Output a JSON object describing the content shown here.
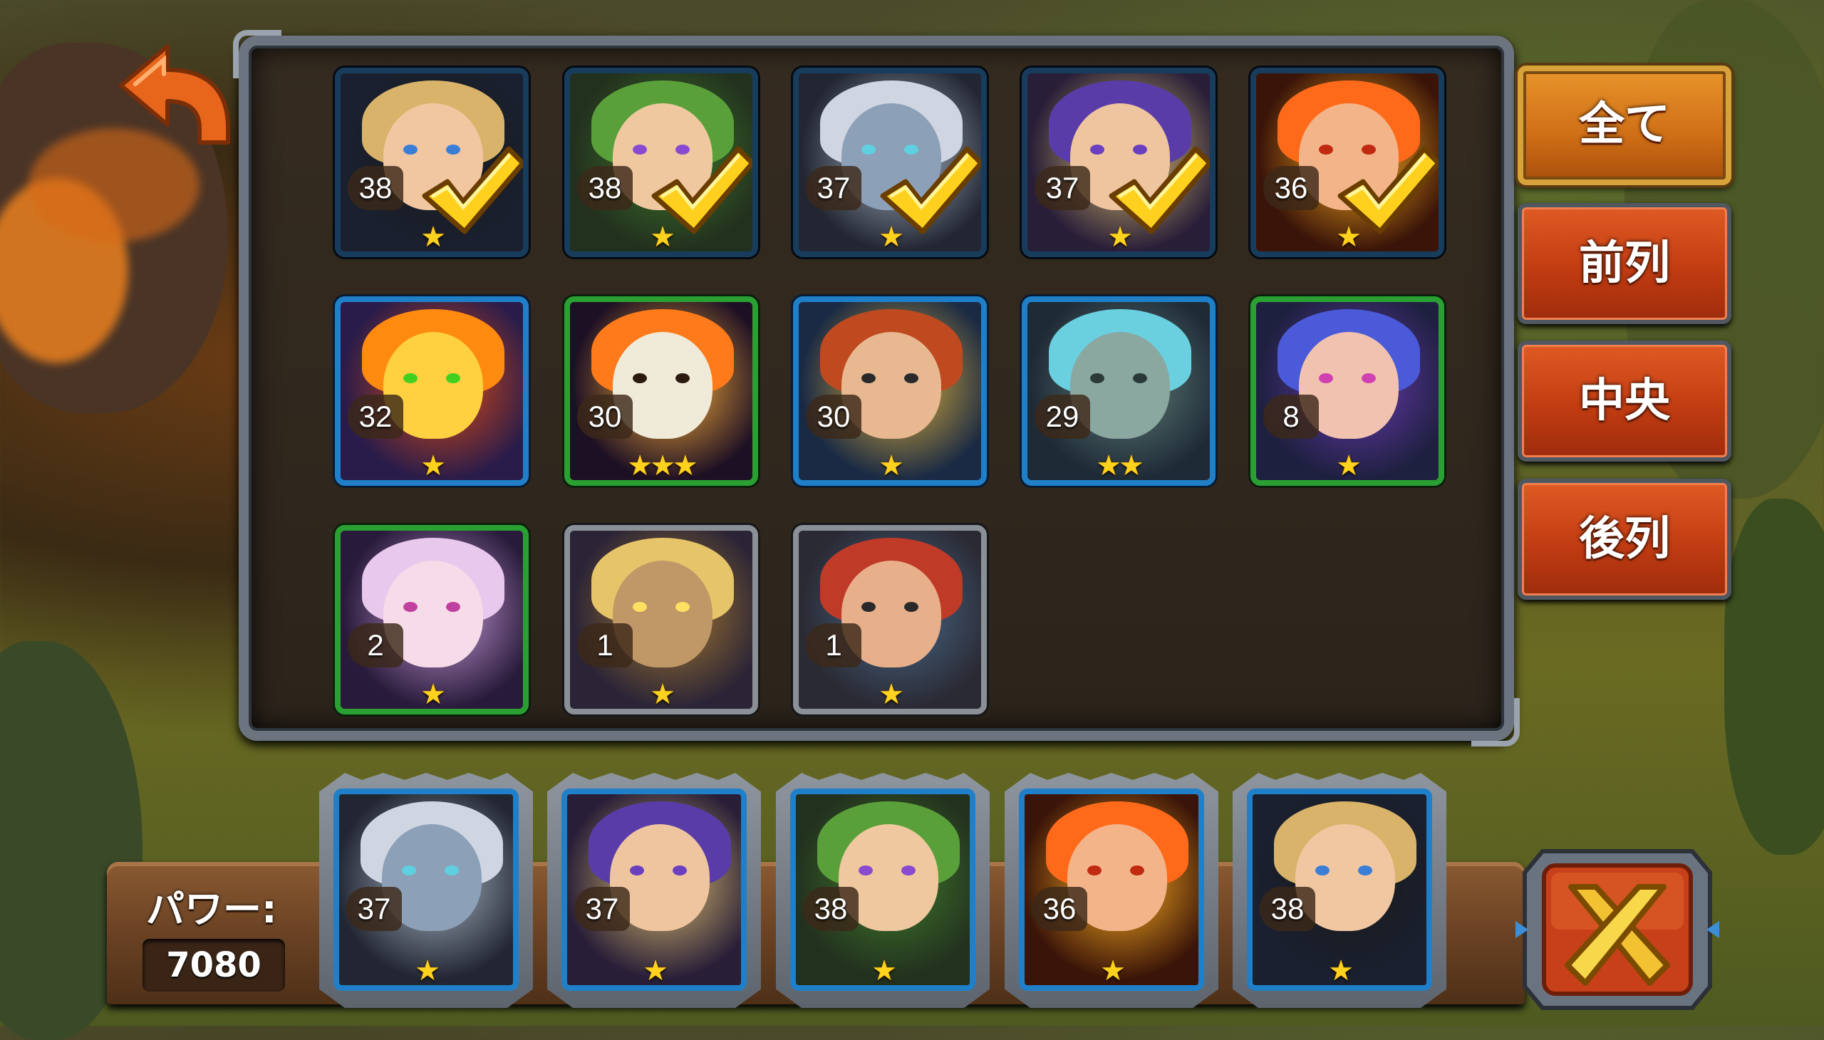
{
  "filters": {
    "all": "全て",
    "front": "前列",
    "middle": "中央",
    "back": "後列"
  },
  "power": {
    "label": "パワー:",
    "value": "7080"
  },
  "colors": {
    "rarity_blue": "#1f7fc8",
    "rarity_green": "#2aa033",
    "rarity_gray": "#8b9096",
    "button_orange": "#c23c12",
    "active_gold": "#cf6e16",
    "star_yellow": "#ffd21e"
  },
  "roster": [
    {
      "level": "38",
      "stars": "★",
      "selected": true,
      "frame": "dark",
      "icon": "pirate-captain-portrait"
    },
    {
      "level": "38",
      "stars": "★",
      "selected": true,
      "frame": "dark",
      "icon": "forest-dryad-portrait"
    },
    {
      "level": "37",
      "stars": "★",
      "selected": true,
      "frame": "dark",
      "icon": "dark-elf-portrait"
    },
    {
      "level": "37",
      "stars": "★",
      "selected": true,
      "frame": "dark",
      "icon": "beast-tamer-portrait"
    },
    {
      "level": "36",
      "stars": "★",
      "selected": true,
      "frame": "dark",
      "icon": "fire-sorceress-portrait"
    },
    {
      "level": "32",
      "stars": "★",
      "selected": false,
      "frame": "blue",
      "icon": "phoenix-portrait"
    },
    {
      "level": "30",
      "stars": "★★★",
      "selected": false,
      "frame": "green",
      "icon": "flaming-skull-portrait"
    },
    {
      "level": "30",
      "stars": "★",
      "selected": false,
      "frame": "blue",
      "icon": "dwarf-knight-portrait"
    },
    {
      "level": "29",
      "stars": "★★",
      "selected": false,
      "frame": "blue",
      "icon": "stone-golem-portrait"
    },
    {
      "level": "8",
      "stars": "★",
      "selected": false,
      "frame": "green",
      "icon": "blue-hair-elf-portrait"
    },
    {
      "level": "2",
      "stars": "★",
      "selected": false,
      "frame": "green",
      "icon": "pale-elf-portrait"
    },
    {
      "level": "1",
      "stars": "★",
      "selected": false,
      "frame": "gray",
      "icon": "golden-warrior-portrait"
    },
    {
      "level": "1",
      "stars": "★",
      "selected": false,
      "frame": "gray",
      "icon": "red-beard-dwarf-portrait"
    }
  ],
  "team": [
    {
      "level": "37",
      "stars": "★",
      "icon": "dark-elf-portrait"
    },
    {
      "level": "37",
      "stars": "★",
      "icon": "beast-tamer-portrait"
    },
    {
      "level": "38",
      "stars": "★",
      "icon": "forest-dryad-portrait"
    },
    {
      "level": "36",
      "stars": "★",
      "icon": "fire-sorceress-portrait"
    },
    {
      "level": "38",
      "stars": "★",
      "icon": "pirate-captain-portrait"
    }
  ]
}
